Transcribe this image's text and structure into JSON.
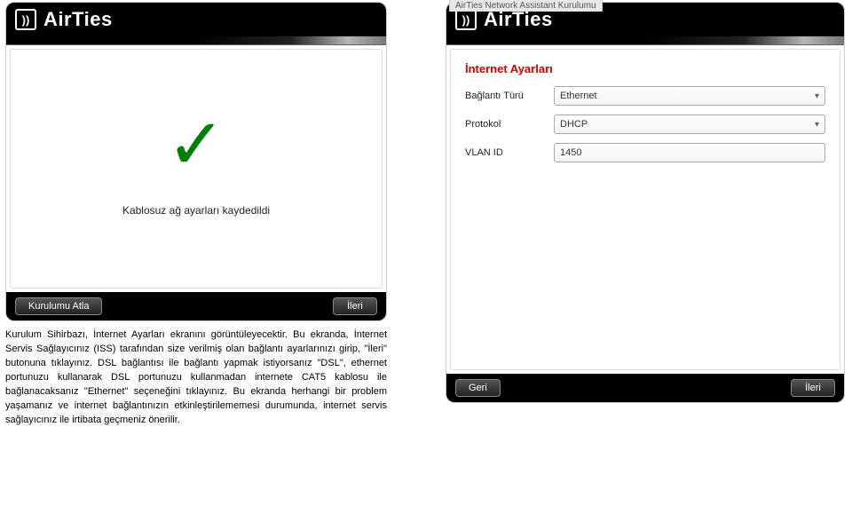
{
  "brand": {
    "name": "AirTies",
    "mark": "))"
  },
  "right_window_title": "AirTies Network Assistant Kurulumu",
  "left": {
    "success_msg": "Kablosuz ağ ayarları kaydedildi",
    "btn_skip": "Kurulumu Atla",
    "btn_next": "İleri"
  },
  "right": {
    "form_title": "İnternet Ayarları",
    "rows": {
      "conn_type": {
        "label": "Bağlantı Türü",
        "value": "Ethernet"
      },
      "protocol": {
        "label": "Protokol",
        "value": "DHCP"
      },
      "vlan": {
        "label": "VLAN ID",
        "value": "1450"
      }
    },
    "btn_back": "Geri",
    "btn_next": "İleri"
  },
  "description": "Kurulum Sihirbazı, İnternet Ayarları ekranını görüntüleyecektir. Bu ekranda, İnternet Servis Sağlayıcınız (ISS) tarafından size verilmiş olan bağlantı ayarlarınızı girip, \"İleri\" butonuna tıklayınız. DSL bağlantısı ile bağlantı yapmak istiyorsanız \"DSL\", ethernet portunuzu kullanarak DSL portunuzu kullanmadan internete CAT5 kablosu ile bağlanacaksanız \"Ethernet\" seçeneğini tıklayınız. Bu ekranda herhangi bir problem yaşamanız ve internet bağlantınızın etkinleştirilememesi durumunda, internet servis sağlayıcınız ile irtibata geçmeniz önerilir."
}
